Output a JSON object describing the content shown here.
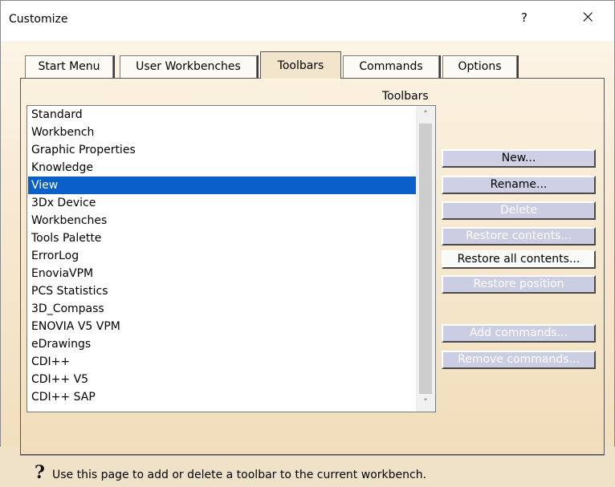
{
  "window": {
    "title": "Customize",
    "help_glyph": "?",
    "close_glyph": "×"
  },
  "tabs": [
    {
      "label": "Start Menu",
      "active": false
    },
    {
      "label": "User Workbenches",
      "active": false
    },
    {
      "label": "Toolbars",
      "active": true
    },
    {
      "label": "Commands",
      "active": false
    },
    {
      "label": "Options",
      "active": false
    }
  ],
  "panel": {
    "group_label": "Toolbars"
  },
  "toolbars_list": {
    "items": [
      "Standard",
      "Workbench",
      "Graphic Properties",
      "Knowledge",
      "View",
      "3Dx Device",
      "Workbenches",
      "Tools Palette",
      "ErrorLog",
      "EnoviaVPM",
      "PCS Statistics",
      "3D_Compass",
      "ENOVIA V5 VPM",
      "eDrawings",
      "CDI++",
      "CDI++ V5",
      "CDI++ SAP"
    ],
    "selected": "View",
    "scroll_up": "^",
    "scroll_down": "v"
  },
  "buttons": {
    "new": "New...",
    "rename": "Rename...",
    "delete": "Delete",
    "restore_contents": "Restore contents...",
    "restore_all_contents": "Restore all contents...",
    "restore_position": "Restore position",
    "add_commands": "Add commands...",
    "remove_commands": "Remove commands..."
  },
  "status": {
    "icon": "question-mark-icon",
    "text": "Use this page to add or delete a toolbar to the current workbench."
  },
  "colors": {
    "selection": "#0a5fc8",
    "button_face": "#cfd0e6"
  }
}
